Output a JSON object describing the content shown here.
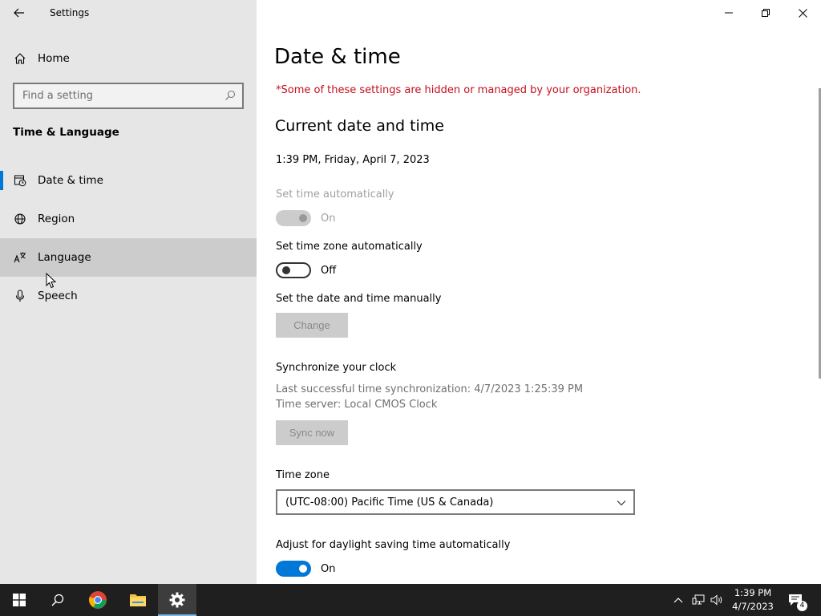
{
  "window": {
    "app_title": "Settings"
  },
  "sidebar": {
    "home_label": "Home",
    "search_placeholder": "Find a setting",
    "section_heading": "Time & Language",
    "items": [
      {
        "label": "Date & time",
        "icon": "date-time-icon",
        "selected": true
      },
      {
        "label": "Region",
        "icon": "globe-icon",
        "selected": false
      },
      {
        "label": "Language",
        "icon": "language-icon",
        "selected": false,
        "hovered": true
      },
      {
        "label": "Speech",
        "icon": "microphone-icon",
        "selected": false
      }
    ]
  },
  "main": {
    "page_title": "Date & time",
    "org_note": "*Some of these settings are hidden or managed by your organization.",
    "current_heading": "Current date and time",
    "current_value": "1:39 PM, Friday, April 7, 2023",
    "set_time_auto": {
      "label": "Set time automatically",
      "state": "On",
      "enabled": false
    },
    "set_timezone_auto": {
      "label": "Set time zone automatically",
      "state": "Off",
      "enabled": true
    },
    "manual": {
      "label": "Set the date and time manually",
      "button": "Change"
    },
    "sync": {
      "heading": "Synchronize your clock",
      "last_sync": "Last successful time synchronization: 4/7/2023 1:25:39 PM",
      "server": "Time server: Local CMOS Clock",
      "button": "Sync now"
    },
    "timezone": {
      "label": "Time zone",
      "value": "(UTC-08:00) Pacific Time (US & Canada)"
    },
    "daylight": {
      "label": "Adjust for daylight saving time automatically",
      "state": "On"
    }
  },
  "taskbar": {
    "time": "1:39 PM",
    "date": "4/7/2023",
    "notification_count": "4"
  },
  "colors": {
    "accent": "#0078d7",
    "warning_text": "#c50f1f",
    "sidebar_bg": "#e6e6e6",
    "taskbar_bg": "#1f1f1f"
  }
}
